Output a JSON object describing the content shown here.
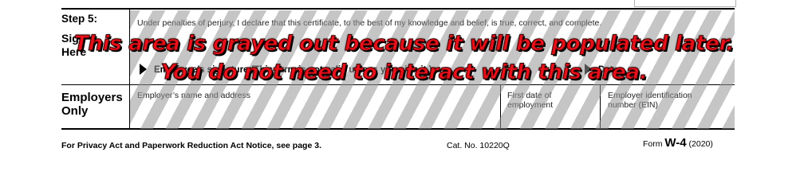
{
  "step5": {
    "title": "Step 5:",
    "sub": "Sign\nHere",
    "perjury": "Under penalties of perjury, I declare that this certificate, to the best of my knowledge and belief, is true, correct, and complete.",
    "employee_signature_label": "Employee’s signature (This form is not valid unless you sign it.)",
    "date_label": "Date"
  },
  "employers": {
    "title": "Employers\nOnly",
    "name_address_label": "Employer’s name and address",
    "first_date_label": "First date of\nemployment",
    "ein_label": "Employer identification\nnumber (EIN)"
  },
  "overlay": {
    "line1": "This area is grayed out because it will be populated later.",
    "line2": "You do not need to interact with this area."
  },
  "footer": {
    "privacy": "For Privacy Act and Paperwork Reduction Act Notice, see page 3.",
    "cat_no": "Cat. No. 10220Q",
    "form_prefix": "Form",
    "form_name": "W-4",
    "form_year": "(2020)"
  },
  "colors": {
    "overlay_text": "#e8101a",
    "stripe": "#969696"
  }
}
